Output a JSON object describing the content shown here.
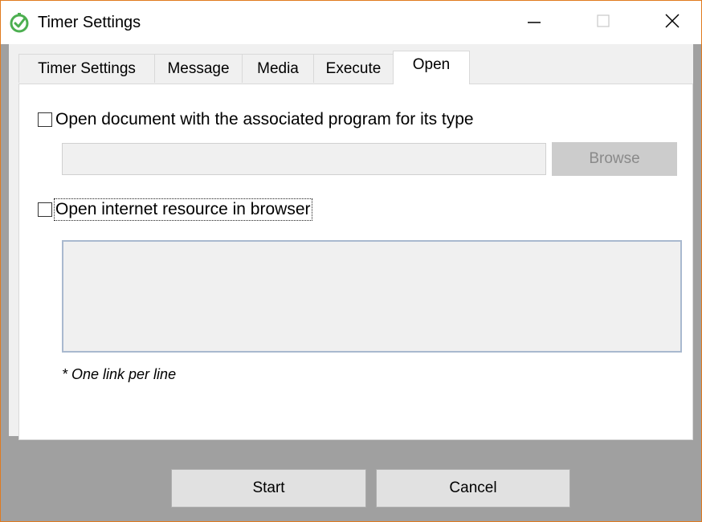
{
  "window": {
    "title": "Timer Settings",
    "icon": "timer-check-icon",
    "controls": {
      "minimize": "minimize-icon",
      "maximize": "maximize-icon",
      "close": "close-icon"
    }
  },
  "tabs": [
    {
      "label": "Timer Settings",
      "active": false
    },
    {
      "label": "Message",
      "active": false
    },
    {
      "label": "Media",
      "active": false
    },
    {
      "label": "Execute",
      "active": false
    },
    {
      "label": "Open",
      "active": true
    }
  ],
  "open_tab": {
    "open_document": {
      "label": "Open document with the associated program for its type",
      "checked": false,
      "path_value": "",
      "browse_label": "Browse"
    },
    "open_internet": {
      "label": "Open internet resource in browser",
      "checked": false,
      "links_value": "",
      "note": "* One link per line"
    }
  },
  "footer": {
    "start_label": "Start",
    "cancel_label": "Cancel"
  },
  "colors": {
    "window_border": "#e07a1f",
    "app_icon_green": "#4caf50",
    "footer_bg": "#a0a0a0",
    "textarea_border": "#a9b9cf"
  }
}
